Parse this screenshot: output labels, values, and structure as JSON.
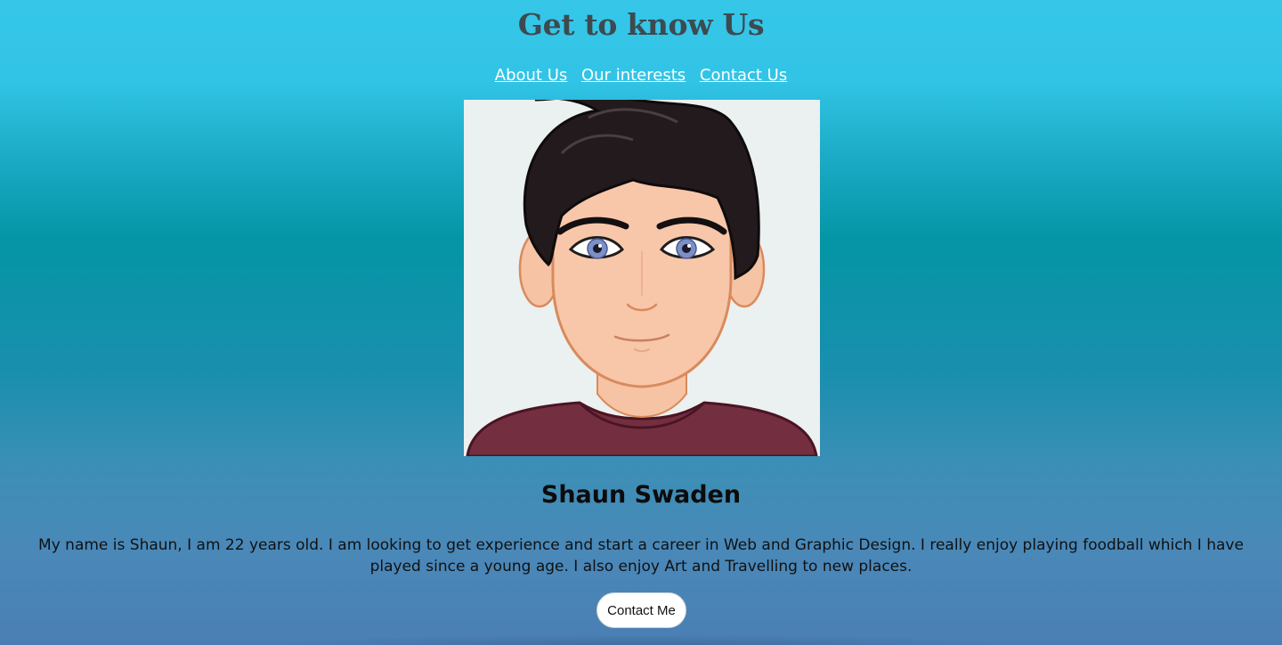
{
  "header": {
    "title": "Get to know Us"
  },
  "nav": {
    "items": [
      {
        "label": "About Us"
      },
      {
        "label": "Our interests"
      },
      {
        "label": "Contact Us"
      }
    ]
  },
  "profile": {
    "avatar_icon": "cartoon-man-avatar",
    "name": "Shaun Swaden",
    "bio": "My name is Shaun, I am 22 years old. I am looking to get experience and start a career in Web and Graphic Design. I really enjoy playing foodball which I have played since a young age. I also enjoy Art and Travelling to new places.",
    "contact_button": "Contact Me"
  },
  "colors": {
    "background_top": "#35c6e8",
    "background_mid": "#0495a6",
    "background_bottom": "#4a7fb4",
    "title": "#3d4a4f",
    "nav_link": "#ffffff"
  }
}
